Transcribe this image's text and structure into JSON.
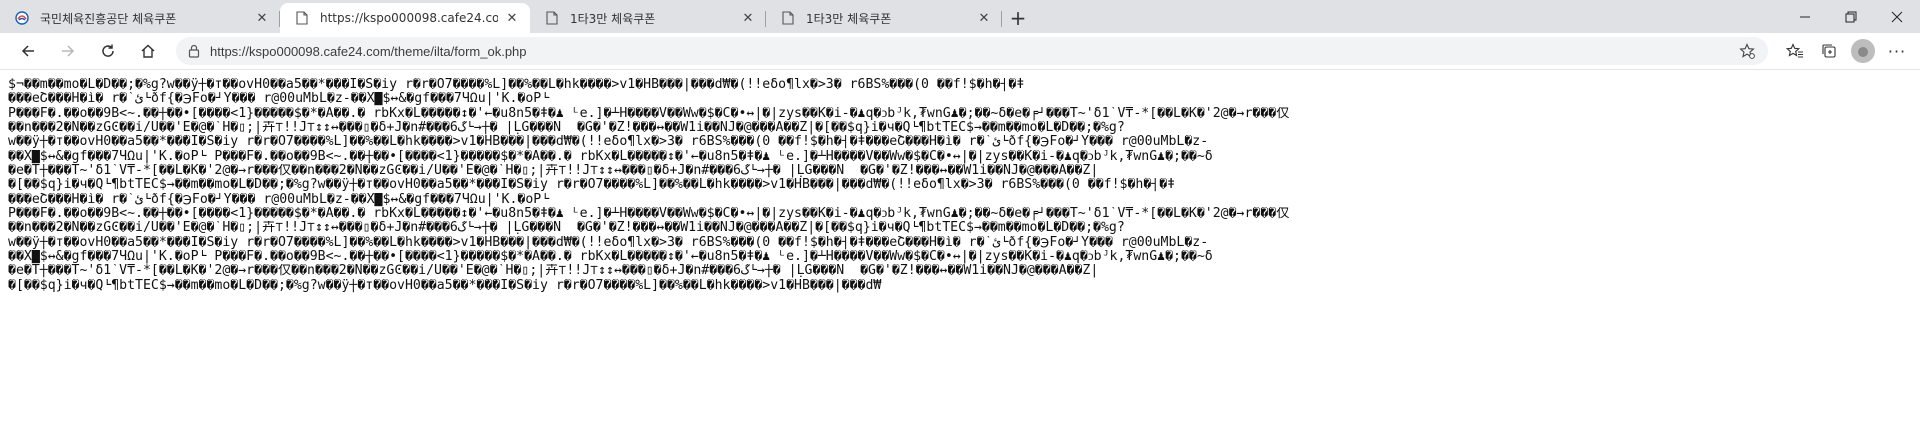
{
  "tabs": [
    {
      "title": "국민체육진흥공단 체육쿠폰",
      "active": false,
      "favicon": "site-logo-icon"
    },
    {
      "title": "https://kspo000098.cafe24.com/",
      "active": true,
      "favicon": "page-icon"
    },
    {
      "title": "1타3만 체육쿠폰",
      "active": false,
      "favicon": "page-icon"
    },
    {
      "title": "1타3만 체육쿠폰",
      "active": false,
      "favicon": "page-icon"
    }
  ],
  "address_bar": {
    "url": "https://kspo000098.cafe24.com/theme/ilta/form_ok.php"
  },
  "page_text": [
    "$¬��m��mo�L�D��;�%g?w��ÿ┼�т��ovH0��a5��*�̀�̀�Ì�S�iy r�r�O7����%L]��%��L�hk����>v1�HB���|���d₩�(!!eδo¶lx�>3� r6BS%���(0 ��f!$�h�┤�ǂ",
    "���eՇ���H�ì� r�`ئ└ðf{�℈Fo�┘Y��� r@00uMbL�z-��X█$↔&�gf���7ЧΩu|'K.�oP└",
    "P���F�.��o��9B<~.��┼��•[����<1}�����$�*�A��.� rbKx�L�����↕�'←�u8n5�ǂ�♟ ᴸe.]�┴H����V��Ww�$�C�•↔|�|zys��K�i-�♟q�ↄbᴶk,₮wnG♟�;��~δ�e�╒┘���Ť~'δ1`V₸-*[��L�K�'2@�→r���仅",
    "��n���2�N��zGϾ��i/U��'E�@�`H�▯;|卉⊤!!J⊤↕↕↔���▯�δ+J�n#���6گ└→┼� |ḶG���N  �G�'�Z!���↔��W1i��NJ�@���A��Z|�[��$q}i�ч�Q└¶btTEC$→��m��mo�L�D��;�%g?",
    "w��ÿ┼�т��ovH0��a5��*�̀�̀�Ì�S�iy r�r�O7����%L]��%��L�hk����>v1�HB���|���d₩�(!!eδo¶lx�>3� r6BS%���(0 ��f!$�h�┤�ǂ���eՇ���H�ì� r�`ئ└ðf{�℈Fo�┘Y��� r@00uMbL�z-",
    "��X█$↔&�gf���7ЧΩu|'K.�oP└ P���F�.��o��9B<~.��┼��•[����<1}�����$�*�A��.� rbKx�L�����↕�'←�u8n5�ǂ�♟ ᴸe.]�┴H����V��Ww�$�C�•↔|�|zys��K�i-�♟q�ↄbᴶk,₮wnG♟�;��~δ",
    "�e�Ť┼���Ť~'δ1`V₸-*[��L�K�'2@�→r���仅��n���2�N��zGϾ��i/U��'E�@�`H�▯;|卉⊤!!J⊤↕↕↔���▯�δ+J�n#���6گ└→┼� |ḶG���N  �G�'�Z!���↔��W1i��NJ�@���A��Z|",
    "�[��$q}i�ч�Q└¶btTEC$→��m��mo�L�D��;�%g?w��ÿ┼�т��ovH0��a5��*�̀�̀�Ì�S�iy r�r�O7����%L]��%��L�hk����>v1�HB���|���d₩�(!!eδo¶lx�>3� r6BS%���(0 ��f!$�h�┤�ǂ",
    "���eՇ���H�ì� r�`ئ└ðf{�℈Fo�┘Y��� r@00uMbL�z-��X█$↔&�gf���7ЧΩu|'K.�oP└",
    "P���F�.��o��9B<~.��┼��•[����<1}�����$�*�A��.� rbKx�L�����↕�'←�u8n5�ǂ�♟ ᴸe.]�┴H����V��Ww�$�C�•↔|�|zys��K�i-�♟q�ↄbᴶk,₮wnG♟�;��~δ�e�╒┘���Ť~'δ1`V₸-*[��L�K�'2@�→r���仅",
    "��n���2�N��zGϾ��i/U��'E�@�`H�▯;|卉⊤!!J⊤↕↕↔���▯�δ+J�n#���6گ└→┼� |ḶG���N  �G�'�Z!���↔��W1i��NJ�@���A��Z|�[��$q}i�ч�Q└¶btTEC$→��m��mo�L�D��;�%g?",
    "w��ÿ┼�т��ovH0��a5��*�̀�̀�Ì�S�iy r�r�O7����%L]��%��L�hk����>v1�HB���|���d₩�(!!eδo¶lx�>3� r6BS%���(0 ��f!$�h�┤�ǂ���eՇ���H�ì� r�`ئ└ðf{�℈Fo�┘Y��� r@00uMbL�z-",
    "��X█$↔&�gf���7ЧΩu|'K.�oP└ P���F�.��o��9B<~.��┼��•[����<1}�����$�*�A��.� rbKx�L�����↕�'←�u8n5�ǂ�♟ ᴸe.]�┴H����V��Ww�$�C�•↔|�|zys��K�i-�♟q�ↄbᴶk,₮wnG♟�;��~δ",
    "�e�Ť┼���Ť~'δ1`V₸-*[��L�K�'2@�→r���仅��n���2�N��zGϾ��i/U��'E�@�`H�▯;|卉⊤!!J⊤↕↕↔���▯�δ+J�n#���6گ└→┼� |ḶG���N  �G�'�Z!���↔��W1i��NJ�@���A��Z|",
    "�[��$q}i�ч�Q└¶btTEC$→��m��mo�L�D��;�%g?w��ÿ┼�т��ovH0��a5��*�̀�̀�Ì�S�iy r�r�O7����%L]��%��L�hk����>v1�HB���|���d₩"
  ]
}
